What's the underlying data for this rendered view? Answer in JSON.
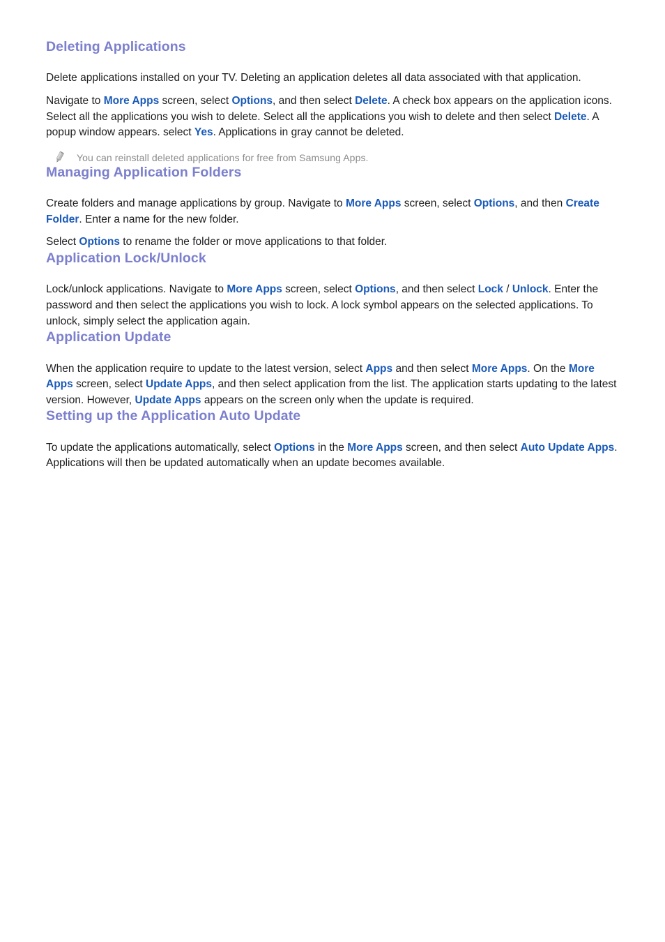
{
  "document": {
    "sections": [
      {
        "id": "deleting-applications",
        "heading": "Deleting Applications",
        "paragraphs": [
          {
            "id": "deleting-p1",
            "runs": [
              {
                "text": "Delete applications installed on your TV. Deleting an application deletes all data associated with that application.",
                "link": false
              }
            ]
          },
          {
            "id": "deleting-p2",
            "runs": [
              {
                "text": "Navigate to ",
                "link": false
              },
              {
                "text": "More Apps",
                "link": true
              },
              {
                "text": " screen, select ",
                "link": false
              },
              {
                "text": "Options",
                "link": true
              },
              {
                "text": ", and then select ",
                "link": false
              },
              {
                "text": "Delete",
                "link": true
              },
              {
                "text": ". A check box appears on the application icons. Select all the applications you wish to delete. Select all the applications you wish to delete and then select ",
                "link": false
              },
              {
                "text": "Delete",
                "link": true
              },
              {
                "text": ". A popup window appears. select ",
                "link": false
              },
              {
                "text": "Yes",
                "link": true
              },
              {
                "text": ". Applications in gray cannot be deleted.",
                "link": false
              }
            ]
          }
        ],
        "note": {
          "icon": "pencil-icon",
          "text": "You can reinstall deleted applications for free from Samsung Apps."
        }
      },
      {
        "id": "managing-application-folders",
        "heading": "Managing Application Folders",
        "paragraphs": [
          {
            "id": "managing-p1",
            "runs": [
              {
                "text": "Create folders and manage applications by group. Navigate to ",
                "link": false
              },
              {
                "text": "More Apps",
                "link": true
              },
              {
                "text": " screen, select ",
                "link": false
              },
              {
                "text": "Options",
                "link": true
              },
              {
                "text": ", and then ",
                "link": false
              },
              {
                "text": "Create Folder",
                "link": true
              },
              {
                "text": ". Enter a name for the new folder.",
                "link": false
              }
            ]
          },
          {
            "id": "managing-p2",
            "runs": [
              {
                "text": "Select ",
                "link": false
              },
              {
                "text": "Options",
                "link": true
              },
              {
                "text": " to rename the folder or move applications to that folder.",
                "link": false
              }
            ]
          }
        ],
        "note": null
      },
      {
        "id": "application-lock-unlock",
        "heading": "Application Lock/Unlock",
        "paragraphs": [
          {
            "id": "lock-p1",
            "runs": [
              {
                "text": "Lock/unlock applications. Navigate to ",
                "link": false
              },
              {
                "text": "More Apps",
                "link": true
              },
              {
                "text": " screen, select ",
                "link": false
              },
              {
                "text": "Options",
                "link": true
              },
              {
                "text": ", and then select ",
                "link": false
              },
              {
                "text": "Lock",
                "link": true
              },
              {
                "text": " / ",
                "link": false
              },
              {
                "text": "Unlock",
                "link": true
              },
              {
                "text": ". Enter the password and then select the applications you wish to lock. A lock symbol appears on the selected applications. To unlock, simply select the application again.",
                "link": false
              }
            ]
          }
        ],
        "note": null
      },
      {
        "id": "application-update",
        "heading": "Application Update",
        "paragraphs": [
          {
            "id": "update-p1",
            "runs": [
              {
                "text": "When the application require to update to the latest version, select ",
                "link": false
              },
              {
                "text": "Apps",
                "link": true
              },
              {
                "text": " and then select ",
                "link": false
              },
              {
                "text": "More Apps",
                "link": true
              },
              {
                "text": ". On the ",
                "link": false
              },
              {
                "text": "More Apps",
                "link": true
              },
              {
                "text": " screen, select ",
                "link": false
              },
              {
                "text": "Update Apps",
                "link": true
              },
              {
                "text": ", and then select application from the list. The application starts updating to the latest version. However, ",
                "link": false
              },
              {
                "text": "Update Apps",
                "link": true
              },
              {
                "text": " appears on the screen only when the update is required.",
                "link": false
              }
            ]
          }
        ],
        "note": null
      },
      {
        "id": "setting-up-the-application-auto-update",
        "heading": "Setting up the Application Auto Update",
        "paragraphs": [
          {
            "id": "autoupdate-p1",
            "runs": [
              {
                "text": "To update the applications automatically, select ",
                "link": false
              },
              {
                "text": "Options",
                "link": true
              },
              {
                "text": " in the ",
                "link": false
              },
              {
                "text": "More Apps",
                "link": true
              },
              {
                "text": " screen, and then select ",
                "link": false
              },
              {
                "text": "Auto Update Apps",
                "link": true
              },
              {
                "text": ". Applications will then be updated automatically when an update becomes available.",
                "link": false
              }
            ]
          }
        ],
        "note": null
      }
    ],
    "colors": {
      "heading": "#7b7fcd",
      "link": "#1a5ab8",
      "body": "#1c1c1c",
      "note": "#8a8a8a",
      "background": "#ffffff"
    }
  }
}
